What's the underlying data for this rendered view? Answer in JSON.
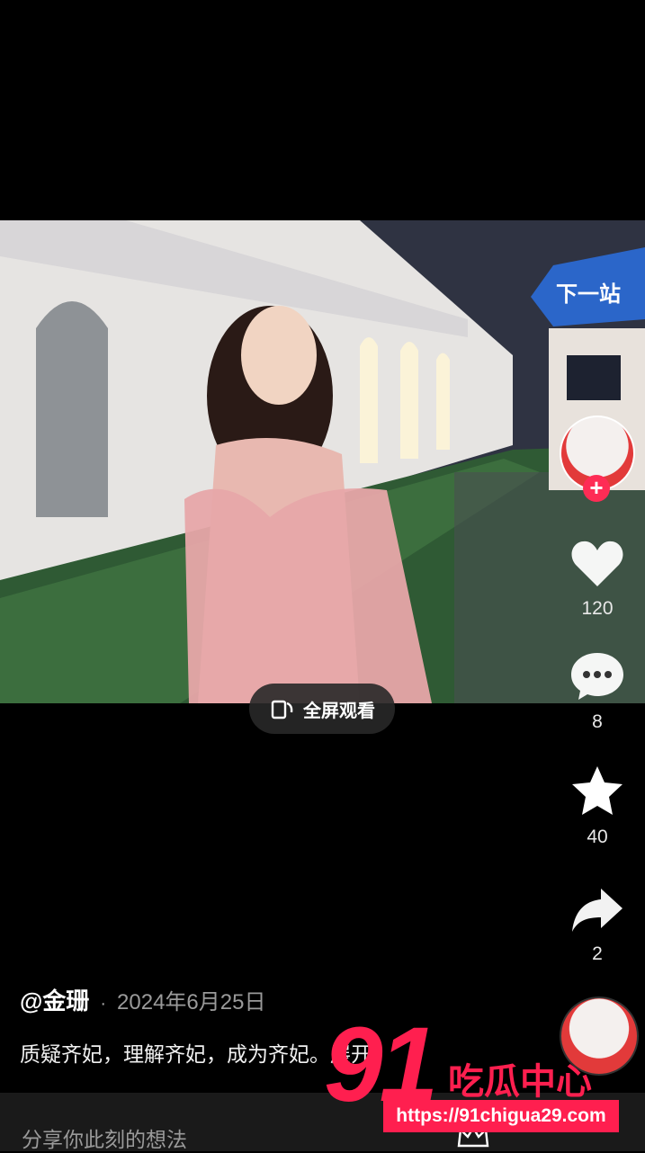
{
  "video": {
    "sign_text": "下一站 ",
    "fullscreen_label": "全屏观看"
  },
  "sidebar": {
    "follow_symbol": "+",
    "like_count": "120",
    "comment_count": "8",
    "favorite_count": "40",
    "share_count": "2"
  },
  "post": {
    "author": "@金珊",
    "separator": "·",
    "date": "2024年6月25日",
    "caption": "质疑齐妃，理解齐妃，成为齐妃。展开"
  },
  "comment": {
    "placeholder": "分享你此刻的想法"
  },
  "watermark": {
    "number": "91",
    "name": "吃瓜中心",
    "url": "https://91chigua29.com"
  },
  "colors": {
    "accent": "#fe2c55",
    "watermark": "#ff1f4f"
  }
}
